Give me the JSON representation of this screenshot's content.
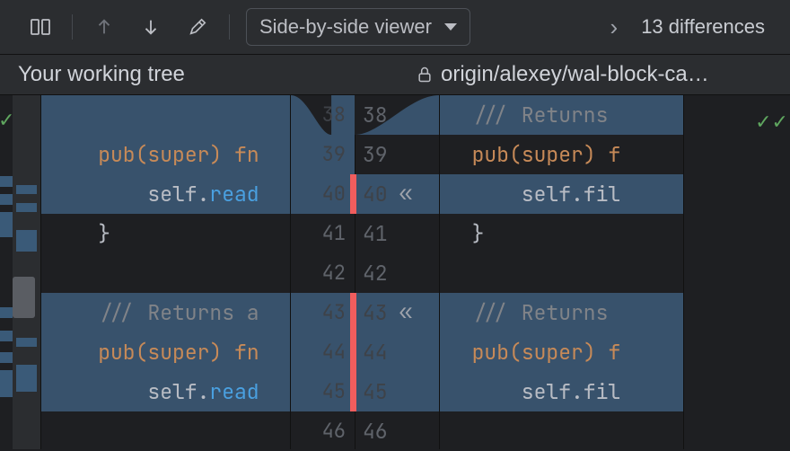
{
  "toolbar": {
    "viewer_label": "Side-by-side viewer",
    "diff_count": "13 differences"
  },
  "headers": {
    "left": "Your working tree",
    "right": "origin/alexey/wal-block-ca…"
  },
  "left_lines": [
    {
      "mod": true,
      "tokens": []
    },
    {
      "mod": true,
      "tokens": [
        [
          "kw",
          "    pub"
        ],
        [
          "paren",
          "("
        ],
        [
          "kw",
          "super"
        ],
        [
          "paren",
          ") "
        ],
        [
          "kw",
          "fn"
        ]
      ]
    },
    {
      "mod": true,
      "tokens": [
        [
          "ident",
          "        self."
        ],
        [
          "fn",
          "read"
        ]
      ]
    },
    {
      "mod": false,
      "tokens": [
        [
          "ident",
          "    }"
        ]
      ]
    },
    {
      "mod": false,
      "tokens": []
    },
    {
      "mod": true,
      "tokens": [
        [
          "doc",
          "    /// Returns a"
        ]
      ]
    },
    {
      "mod": true,
      "tokens": [
        [
          "kw",
          "    pub"
        ],
        [
          "paren",
          "("
        ],
        [
          "kw",
          "super"
        ],
        [
          "paren",
          ") "
        ],
        [
          "kw",
          "fn"
        ]
      ]
    },
    {
      "mod": true,
      "tokens": [
        [
          "ident",
          "        self."
        ],
        [
          "fn",
          "read"
        ]
      ]
    },
    {
      "mod": false,
      "tokens": []
    }
  ],
  "right_lines": [
    {
      "mod": true,
      "tokens": [
        [
          "doc",
          "  /// Returns "
        ]
      ]
    },
    {
      "mod": false,
      "tokens": [
        [
          "kw",
          "  pub"
        ],
        [
          "paren",
          "("
        ],
        [
          "kw",
          "super"
        ],
        [
          "paren",
          ") "
        ],
        [
          "kw",
          "f"
        ]
      ]
    },
    {
      "mod": true,
      "tokens": [
        [
          "ident",
          "      self.fil"
        ]
      ]
    },
    {
      "mod": false,
      "tokens": [
        [
          "ident",
          "  }"
        ]
      ]
    },
    {
      "mod": false,
      "tokens": []
    },
    {
      "mod": true,
      "tokens": [
        [
          "doc",
          "  /// Returns "
        ]
      ]
    },
    {
      "mod": true,
      "tokens": [
        [
          "kw",
          "  pub"
        ],
        [
          "paren",
          "("
        ],
        [
          "kw",
          "super"
        ],
        [
          "paren",
          ") "
        ],
        [
          "kw",
          "f"
        ]
      ]
    },
    {
      "mod": true,
      "tokens": [
        [
          "ident",
          "      self.fil"
        ]
      ]
    },
    {
      "mod": false,
      "tokens": []
    }
  ],
  "gutter_left": [
    {
      "n": "38",
      "dim": true,
      "mod": true
    },
    {
      "n": "39",
      "dim": true,
      "mod": true
    },
    {
      "n": "40",
      "dim": true,
      "mod": true
    },
    {
      "n": "41",
      "dim": false,
      "mod": false
    },
    {
      "n": "42",
      "dim": false,
      "mod": false
    },
    {
      "n": "43",
      "dim": true,
      "mod": true
    },
    {
      "n": "44",
      "dim": true,
      "mod": true
    },
    {
      "n": "45",
      "dim": true,
      "mod": true
    },
    {
      "n": "46",
      "dim": false,
      "mod": false
    }
  ],
  "mid_right": [
    {
      "n": "38",
      "red": false,
      "chev": false,
      "mod": true,
      "curve": true
    },
    {
      "n": "39",
      "red": false,
      "chev": false,
      "mod": false
    },
    {
      "n": "40",
      "red": true,
      "chev": true,
      "mod": true,
      "dim": true
    },
    {
      "n": "41",
      "red": false,
      "chev": false,
      "mod": false
    },
    {
      "n": "42",
      "red": false,
      "chev": false,
      "mod": false
    },
    {
      "n": "43",
      "red": true,
      "chev": true,
      "mod": true,
      "dim": true
    },
    {
      "n": "44",
      "red": true,
      "chev": false,
      "mod": true,
      "dim": true
    },
    {
      "n": "45",
      "red": true,
      "chev": false,
      "mod": true,
      "dim": true
    },
    {
      "n": "46",
      "red": false,
      "chev": false,
      "mod": false
    }
  ]
}
